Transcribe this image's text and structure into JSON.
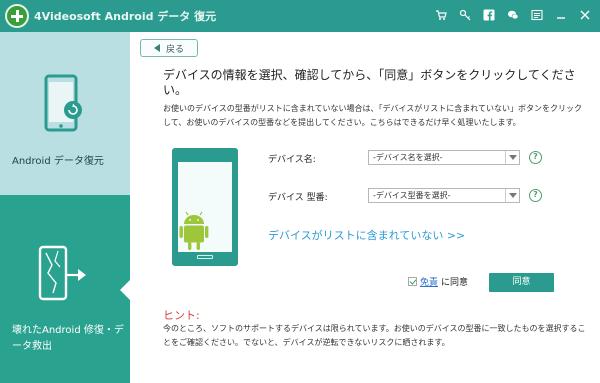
{
  "titlebar": {
    "app_title": "4Videosoft Android データ 復元",
    "icons": [
      "cart-icon",
      "key-icon",
      "facebook-icon",
      "chat-icon",
      "menu-icon",
      "minimize-icon",
      "close-icon"
    ]
  },
  "sidebar": {
    "items": [
      {
        "label": "Android データ復元",
        "icon": "phone-recovery-icon",
        "selected": false
      },
      {
        "label": "壊れたAndroid 修復・データ救出",
        "icon": "broken-phone-icon",
        "selected": true
      }
    ]
  },
  "main": {
    "back_label": "戻る",
    "heading": "デバイスの情報を選択、確認してから、「同意」ボタンをクリックしてください。",
    "description": "お使いのデバイスの型番がリストに含まれていない場合は、「デバイスがリストに含まれていない」ボタンをクリックして、お使いのデバイスの型番などを提出してください。こちらはできるだけ早く処理いたします。",
    "device_name_label": "デバイス名:",
    "device_name_value": "-デバイス名を選択-",
    "device_model_label": "デバイス 型番:",
    "device_model_value": "-デバイス型番を選択-",
    "not_in_list_link": "デバイスがリストに含まれていない >>",
    "terms_link": "免責",
    "agree_suffix": "に同意",
    "agree_checked": true,
    "agree_button": "同意",
    "hint_title": "ヒント:",
    "hint_text": "今のところ、ソフトのサポートするデバイスは限られています。お使いのデバイスの型番に一致したものを選択することをご確認ください。でないと、デバイスが逆転できないリスクに晒されます。"
  },
  "colors": {
    "accent": "#2a9b8e",
    "sidebar_top": "#b9dfe2",
    "sidebar_bottom": "#29a290",
    "link": "#2f9bd7",
    "hint": "#d83b3b",
    "android_green": "#9dc63a"
  }
}
